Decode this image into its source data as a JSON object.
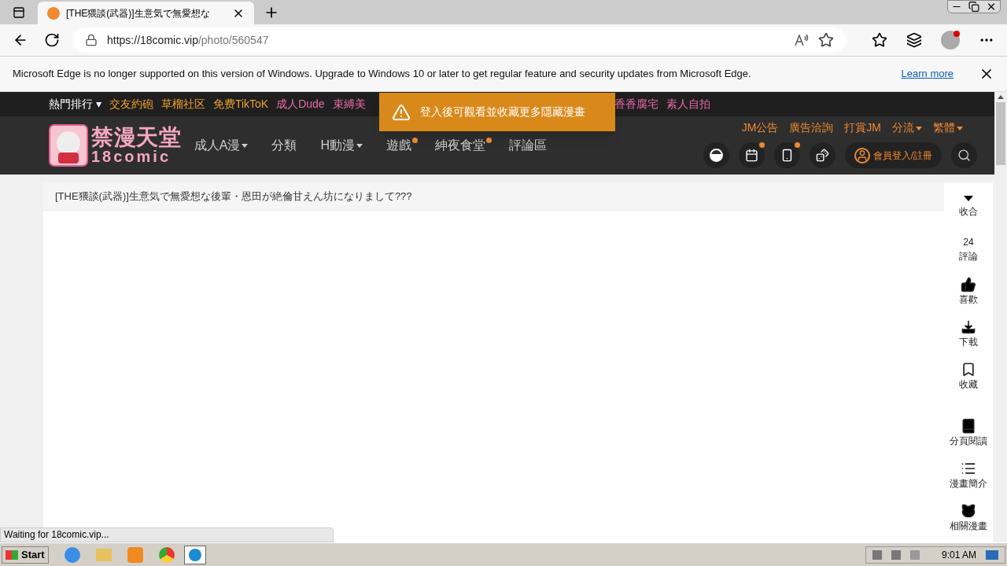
{
  "browser": {
    "tab_title": "[THE猥談(武器)]生意気で無愛想な",
    "url_host": "https://18comic.vip",
    "url_path": "/photo/560547"
  },
  "infobar": {
    "message": "Microsoft Edge is no longer supported on this version of Windows. Upgrade to Windows 10 or later to get regular feature and security updates from Microsoft Edge.",
    "link": "Learn more"
  },
  "topnav": [
    {
      "label": "熱門排行 ▾",
      "color": "#ffffff"
    },
    {
      "label": "交友約砲",
      "color": "#f0a030"
    },
    {
      "label": "草榴社区",
      "color": "#f0a030"
    },
    {
      "label": "免费TikToK",
      "color": "#f0a030"
    },
    {
      "label": "成人Dude",
      "color": "#e86aa8"
    },
    {
      "label": "束縛美",
      "color": "#e86aa8"
    }
  ],
  "topnav_right": [
    {
      "label": "香香腐宅",
      "color": "#e86aa8"
    },
    {
      "label": "素人自拍",
      "color": "#e86aa8"
    }
  ],
  "toast": "登入後可觀看並收藏更多隱藏漫畫",
  "logo": {
    "title": "禁漫天堂",
    "subtitle": "18comic"
  },
  "mainnav": [
    {
      "label": "成人A漫",
      "dropdown": true,
      "dot": false
    },
    {
      "label": "分類",
      "dropdown": false,
      "dot": false
    },
    {
      "label": "H動漫",
      "dropdown": true,
      "dot": false
    },
    {
      "label": "遊戲",
      "dropdown": false,
      "dot": true
    },
    {
      "label": "紳夜食堂",
      "dropdown": false,
      "dot": true
    },
    {
      "label": "評論區",
      "dropdown": false,
      "dot": false
    }
  ],
  "links": [
    {
      "label": "JM公告",
      "dropdown": false
    },
    {
      "label": "廣告洽詢",
      "dropdown": false
    },
    {
      "label": "打賞JM",
      "dropdown": false
    },
    {
      "label": "分流",
      "dropdown": true
    },
    {
      "label": "繁體",
      "dropdown": true
    }
  ],
  "icon_buttons": [
    {
      "kind": "ball",
      "dot": false
    },
    {
      "kind": "calendar",
      "dot": true
    },
    {
      "kind": "phone",
      "dot": true
    },
    {
      "kind": "dice",
      "dot": false
    }
  ],
  "login": "會員登入/註冊",
  "page_title": "[THE猥談(武器)]生意気で無愛想な後輩・恩田が絶倫甘えん坊になりまして???",
  "side": [
    {
      "kind": "collapse",
      "label": "收合"
    },
    {
      "kind": "count",
      "count": "24",
      "label": "評論"
    },
    {
      "kind": "like",
      "label": "喜歡"
    },
    {
      "kind": "download",
      "label": "下載"
    },
    {
      "kind": "bookmark",
      "label": "收藏"
    },
    {
      "kind": "book",
      "label": "分頁閱讀"
    },
    {
      "kind": "list",
      "label": "漫畫簡介"
    },
    {
      "kind": "cat",
      "label": "相關漫畫"
    }
  ],
  "status": "Waiting for 18comic.vip...",
  "taskbar": {
    "start": "Start",
    "clock": "9:01 AM"
  }
}
